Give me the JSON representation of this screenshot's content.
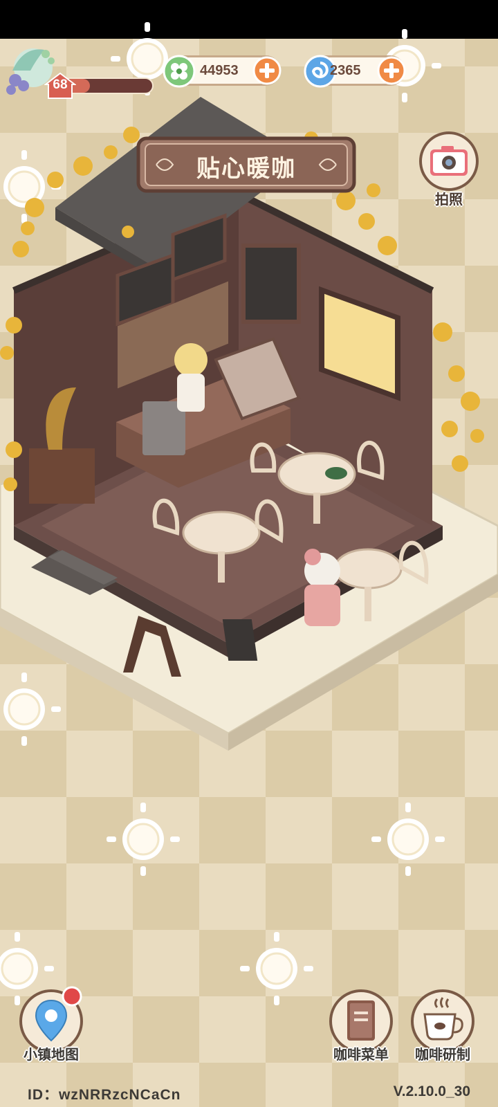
{
  "hud": {
    "level": "68",
    "level_progress": 0.3,
    "clover_currency": "44953",
    "swirl_currency": "2365"
  },
  "shop": {
    "name": "贴心暖咖"
  },
  "actions": {
    "camera_label": "拍照",
    "town_map_label": "小镇地图",
    "coffee_menu_label": "咖啡菜单",
    "coffee_brew_label": "咖啡研制"
  },
  "footer": {
    "id_text": "ID：wzNRRzcNCaCn",
    "version": "V.2.10.0_30"
  },
  "colors": {
    "accent_orange": "#f08a45",
    "wood_brown": "#6b4a3c",
    "ginkgo_yellow": "#e8b53a",
    "notification_red": "#e04848"
  },
  "icons": {
    "clover": "clover-icon",
    "swirl": "swirl-icon",
    "camera": "camera-icon",
    "map_pin": "map-pin-icon",
    "menu_book": "book-icon",
    "coffee_cup": "coffee-cup-icon"
  }
}
